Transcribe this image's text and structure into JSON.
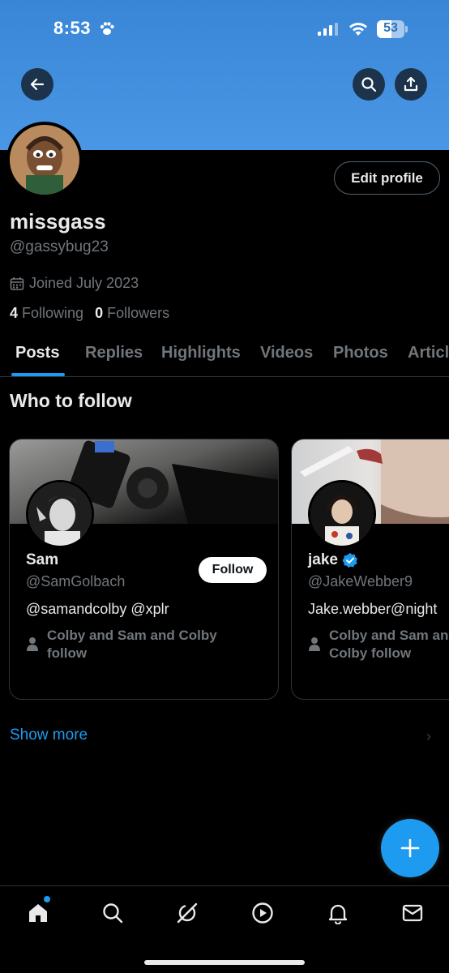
{
  "status_bar": {
    "time": "8:53",
    "battery": "53",
    "icons": [
      "paw-icon",
      "signal-icon",
      "wifi-icon",
      "battery-icon"
    ]
  },
  "header": {
    "banner_color": "#4a97e6",
    "buttons": [
      "back-arrow-icon",
      "search-icon",
      "share-icon"
    ]
  },
  "profile": {
    "display_name": "missgass",
    "handle": "@gassybug23",
    "joined": "Joined July 2023",
    "following_count": "4",
    "following_label": "Following",
    "followers_count": "0",
    "followers_label": "Followers",
    "edit_label": "Edit profile"
  },
  "tabs": [
    {
      "label": "Posts",
      "active": true
    },
    {
      "label": "Replies",
      "active": false
    },
    {
      "label": "Highlights",
      "active": false
    },
    {
      "label": "Videos",
      "active": false
    },
    {
      "label": "Photos",
      "active": false
    },
    {
      "label": "Articles",
      "active": false
    }
  ],
  "who_to_follow": {
    "title": "Who to follow",
    "cards": [
      {
        "name": "Sam",
        "handle": "@SamGolbach",
        "bio": "@samandcolby @xplr",
        "social_context": "Colby and Sam and Colby follow",
        "follow_label": "Follow",
        "verified": false
      },
      {
        "name": "jake",
        "handle": "@JakeWebber9",
        "bio": "Jake.webber@night",
        "social_context": "Colby and Sam and Colby follow",
        "verified": true
      }
    ],
    "show_more": "Show more"
  },
  "fab": {
    "icon": "plus-icon"
  },
  "bottom_nav": [
    {
      "icon": "home-icon",
      "active": true
    },
    {
      "icon": "search-icon"
    },
    {
      "icon": "grok-icon"
    },
    {
      "icon": "video-play-icon"
    },
    {
      "icon": "bell-icon"
    },
    {
      "icon": "mail-icon"
    }
  ],
  "colors": {
    "accent": "#1d9bf0",
    "background": "#000000",
    "secondary_text": "#71767b"
  }
}
